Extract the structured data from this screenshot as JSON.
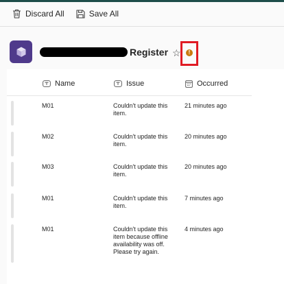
{
  "toolbar": {
    "discard_label": "Discard All",
    "save_label": "Save All"
  },
  "header": {
    "title": "Register"
  },
  "table": {
    "columns": [
      {
        "label": "Name",
        "icon": "text-field-icon"
      },
      {
        "label": "Issue",
        "icon": "text-field-icon"
      },
      {
        "label": "Occurred",
        "icon": "calendar-icon"
      }
    ],
    "rows": [
      {
        "name": "M01",
        "issue": "Couldn't update this item.",
        "occurred": "21 minutes ago"
      },
      {
        "name": "M02",
        "issue": "Couldn't update this item.",
        "occurred": "20 minutes ago"
      },
      {
        "name": "M03",
        "issue": "Couldn't update this item.",
        "occurred": "20 minutes ago"
      },
      {
        "name": "M01",
        "issue": "Couldn't update this item.",
        "occurred": "7 minutes ago"
      },
      {
        "name": "M01",
        "issue": "Couldn't update this item because offline availability was off. Please try again.",
        "occurred": "4 minutes ago"
      }
    ]
  },
  "colors": {
    "brand": "#4f3a8b",
    "warning": "#c97a0e",
    "highlight": "#e01b24"
  }
}
